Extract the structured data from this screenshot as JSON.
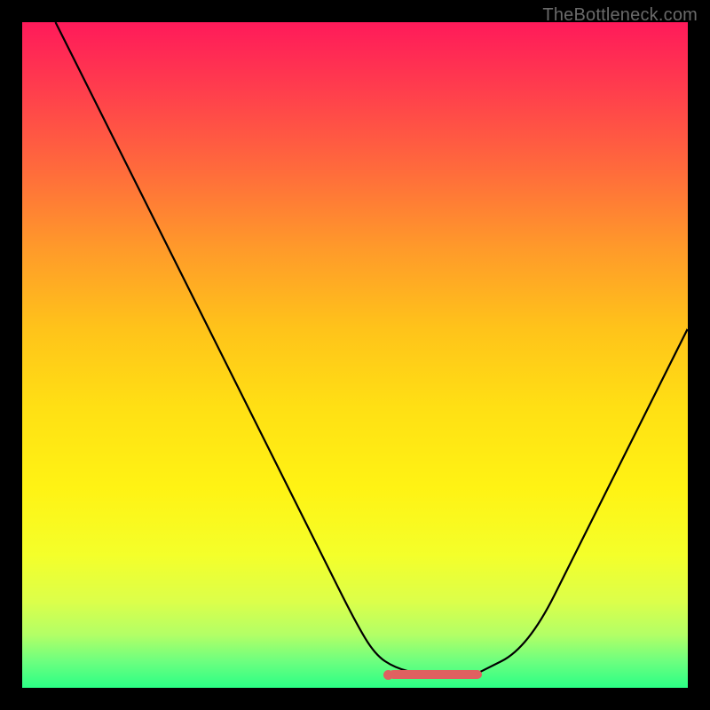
{
  "watermark": "TheBottleneck.com",
  "chart_data": {
    "type": "line",
    "title": "",
    "xlabel": "",
    "ylabel": "",
    "xlim": [
      0,
      100
    ],
    "ylim": [
      0,
      100
    ],
    "grid": false,
    "series": [
      {
        "name": "bottleneck-curve",
        "x": [
          5,
          10,
          15,
          20,
          25,
          30,
          35,
          40,
          45,
          50,
          53,
          56,
          60,
          64,
          68,
          70,
          74,
          78,
          82,
          86,
          90,
          95,
          100
        ],
        "values": [
          100,
          90,
          80,
          70,
          60,
          50,
          40,
          30,
          20,
          10,
          5,
          3,
          2,
          2,
          2,
          3,
          5,
          10,
          18,
          26,
          34,
          44,
          54
        ]
      }
    ],
    "optimal_range": {
      "start_x": 55,
      "end_x": 69,
      "y": 2
    },
    "optimal_marker_dot": {
      "x": 55,
      "y": 2
    },
    "gradient": {
      "top_color": "#ff1a5a",
      "mid_color": "#ffe014",
      "bottom_color": "#2bff85"
    },
    "indicator_color": "#e06060"
  }
}
